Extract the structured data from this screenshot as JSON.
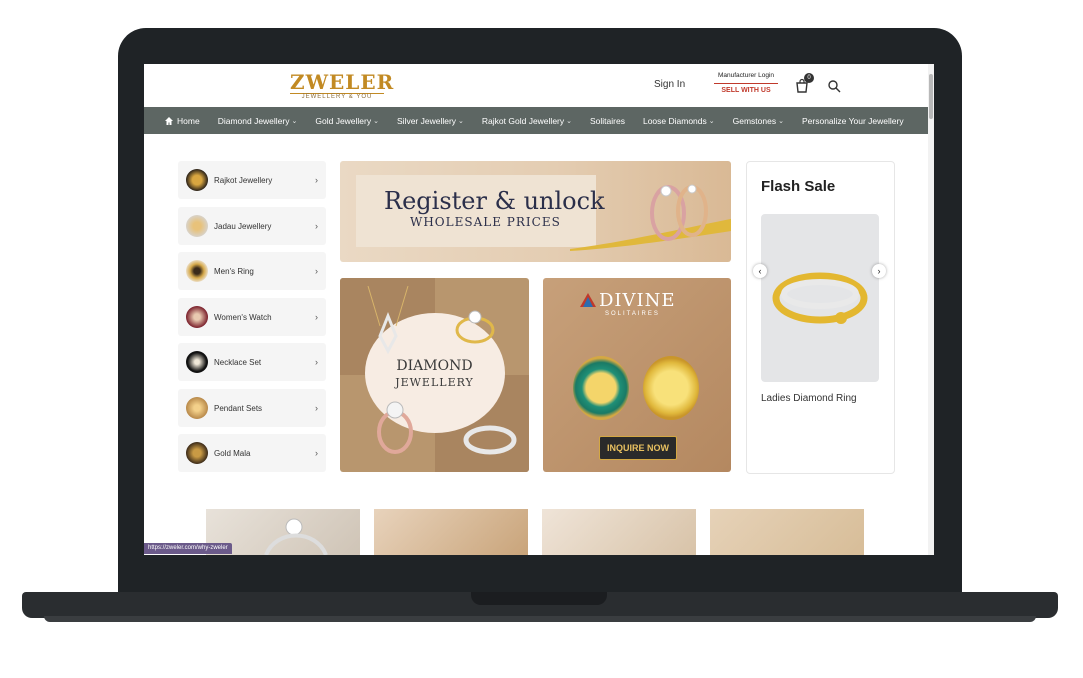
{
  "header": {
    "logo_main": "ZWELER",
    "logo_sub": "JEWELLERY & YOU",
    "signin_label": "Sign In",
    "manufacturer_login": "Manufacturer Login",
    "sell_with_us": "SELL WITH US",
    "cart_count": "0"
  },
  "nav": {
    "items": [
      {
        "label": "Home",
        "icon": "home-icon"
      },
      {
        "label": "Diamond Jewellery",
        "dropdown": true
      },
      {
        "label": "Gold Jewellery",
        "dropdown": true
      },
      {
        "label": "Silver Jewellery",
        "dropdown": true
      },
      {
        "label": "Rajkot Gold Jewellery",
        "dropdown": true
      },
      {
        "label": "Solitaires",
        "dropdown": false
      },
      {
        "label": "Loose Diamonds",
        "dropdown": true
      },
      {
        "label": "Gemstones",
        "dropdown": true
      },
      {
        "label": "Personalize Your Jewellery",
        "dropdown": false
      }
    ],
    "color": "#5d6663"
  },
  "categories": [
    {
      "label": "Rajkot Jewellery"
    },
    {
      "label": "Jadau Jewellery"
    },
    {
      "label": "Men's Ring"
    },
    {
      "label": "Women's Watch"
    },
    {
      "label": "Necklace Set"
    },
    {
      "label": "Pendant Sets"
    },
    {
      "label": "Gold Mala"
    }
  ],
  "banners": {
    "register_line1": "Register & unlock",
    "register_line2": "WHOLESALE PRICES",
    "diamond_line1": "DIAMOND",
    "diamond_line2": "JEWELLERY",
    "divine_title": "DIVINE",
    "divine_sub": "SOLITAIRES",
    "inquire_label": "INQUIRE NOW"
  },
  "flash_sale": {
    "title": "Flash Sale",
    "product_name": "Ladies Diamond Ring",
    "prev_label": "‹",
    "next_label": "›"
  },
  "status_bar": {
    "url": "https://zweler.com/why-zweler"
  },
  "colors": {
    "brand_gold": "#c28a23",
    "sell_red": "#c0392b"
  }
}
